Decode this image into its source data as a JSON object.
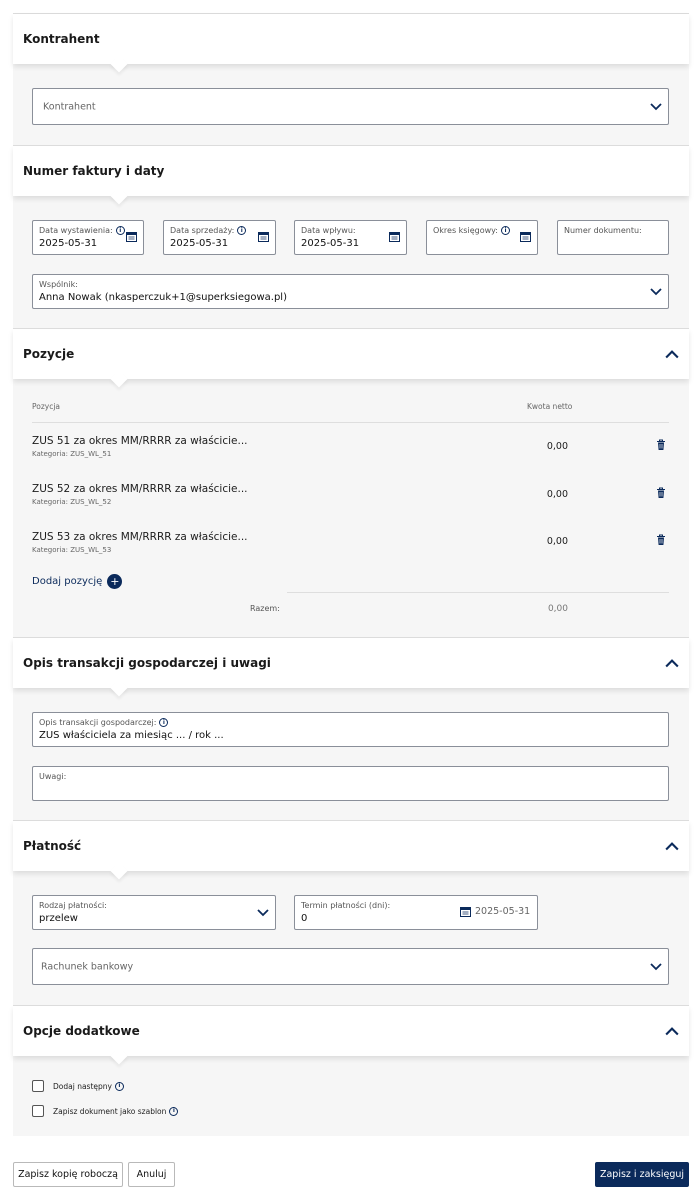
{
  "contractor": {
    "title": "Kontrahent",
    "select_placeholder": "Kontrahent"
  },
  "invoice": {
    "title": "Numer faktury i daty",
    "issue_date": {
      "label": "Data wystawienia:",
      "value": "2025-05-31"
    },
    "sale_date": {
      "label": "Data sprzedaży:",
      "value": "2025-05-31"
    },
    "receipt_date": {
      "label": "Data wpływu:",
      "value": "2025-05-31"
    },
    "accounting_period": {
      "label": "Okres księgowy:",
      "value": ""
    },
    "document_number": {
      "label": "Numer dokumentu:",
      "value": ""
    },
    "partner": {
      "label": "Wspólnik:",
      "value": "Anna Nowak (nkasperczuk+1@superksiegowa.pl)"
    }
  },
  "positions": {
    "title": "Pozycje",
    "col_position": "Pozycja",
    "col_net": "Kwota netto",
    "rows": [
      {
        "name": "ZUS 51 za okres MM/RRRR za właścicie...",
        "category": "Kategoria: ZUS_WL_51",
        "amount": "0,00"
      },
      {
        "name": "ZUS 52 za okres MM/RRRR za właścicie...",
        "category": "Kategoria: ZUS_WL_52",
        "amount": "0,00"
      },
      {
        "name": "ZUS 53 za okres MM/RRRR za właścicie...",
        "category": "Kategoria: ZUS_WL_53",
        "amount": "0,00"
      }
    ],
    "add_label": "Dodaj pozycję",
    "total_label": "Razem:",
    "total_value": "0,00"
  },
  "description": {
    "title": "Opis transakcji gospodarczej i uwagi",
    "transaction": {
      "label": "Opis transakcji gospodarczej:",
      "value": "ZUS właściciela za miesiąc ... / rok ..."
    },
    "notes": {
      "label": "Uwagi:",
      "value": ""
    }
  },
  "payment": {
    "title": "Płatność",
    "type": {
      "label": "Rodzaj płatności:",
      "value": "przelew"
    },
    "term": {
      "label": "Termin płatności (dni):",
      "value": "0",
      "date": "2025-05-31"
    },
    "bank_account_placeholder": "Rachunek bankowy"
  },
  "options": {
    "title": "Opcje dodatkowe",
    "add_next": "Dodaj następny",
    "save_template": "Zapisz dokument jako szablon"
  },
  "footer": {
    "save_draft": "Zapisz kopię roboczą",
    "cancel": "Anuluj",
    "save_post": "Zapisz i zaksięguj"
  },
  "icons": {
    "calendar": "calendar-icon",
    "chevron_down": "chevron-down-icon",
    "chevron_up": "chevron-up-icon",
    "trash": "trash-icon",
    "info": "info-icon",
    "plus": "plus-icon"
  },
  "colors": {
    "accent": "#0b2a5b",
    "panel_bg": "#f6f6f6"
  }
}
